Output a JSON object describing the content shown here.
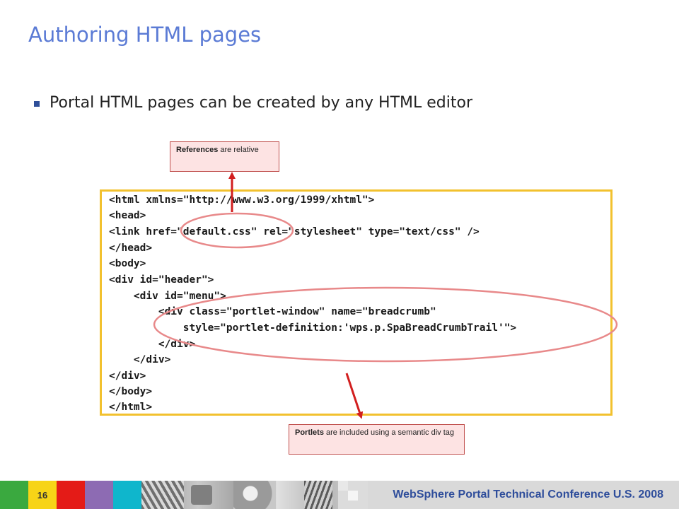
{
  "slide": {
    "title": "Authoring HTML pages",
    "bullet": "Portal HTML pages can be created by any HTML editor"
  },
  "callouts": {
    "top": {
      "bold": "References",
      "rest": " are relative"
    },
    "bottom": {
      "bold": "Portlets",
      "rest": " are included using a semantic div tag"
    }
  },
  "code": {
    "lines": [
      "<html xmlns=\"http://www.w3.org/1999/xhtml\">",
      "<head>",
      "<link href=\"default.css\" rel=\"stylesheet\" type=\"text/css\" />",
      "</head>",
      "<body>",
      "<div id=\"header\">",
      "    <div id=\"menu\">",
      "        <div class=\"portlet-window\" name=\"breadcrumb\"",
      "            style=\"portlet-definition:'wps.p.SpaBreadCrumbTrail'\">",
      "        </div>",
      "    </div>",
      "</div>",
      "</body>",
      "</html>"
    ]
  },
  "footer": {
    "page_number": "16",
    "tagline": "WebSphere Portal Technical Conference U.S. 2008"
  },
  "colors": {
    "title": "#5b7bd5",
    "code_border": "#f2c12e",
    "highlight": "#e8898a",
    "arrow": "#d21f1f",
    "callout_bg": "#fde3e3"
  }
}
